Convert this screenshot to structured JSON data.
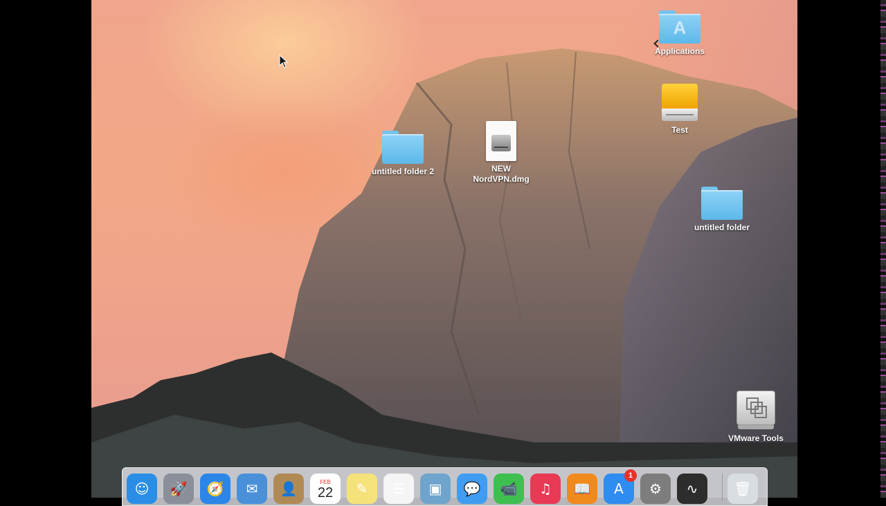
{
  "desktop": {
    "icons": [
      {
        "label": "Applications",
        "kind": "folder-alias"
      },
      {
        "label": "Test",
        "kind": "drive"
      },
      {
        "label": "untitled folder 2",
        "kind": "folder"
      },
      {
        "label": "NEW\nNordVPN.dmg",
        "kind": "dmg"
      },
      {
        "label": "untitled folder",
        "kind": "folder"
      },
      {
        "label": "VMware Tools",
        "kind": "vmware-volume"
      }
    ]
  },
  "dock": {
    "items": [
      {
        "name": "finder-icon",
        "glyph": "☺",
        "color": "#2a8ee6"
      },
      {
        "name": "launchpad-icon",
        "glyph": "🚀",
        "color": "#8a8f9a"
      },
      {
        "name": "safari-icon",
        "glyph": "🧭",
        "color": "#2b86e8"
      },
      {
        "name": "mail-icon",
        "glyph": "✉",
        "color": "#4a90d9"
      },
      {
        "name": "contacts-icon",
        "glyph": "👤",
        "color": "#b08a55"
      },
      {
        "name": "calendar-icon",
        "month": "FEB",
        "day": "22",
        "color": "#ffffff"
      },
      {
        "name": "notes-icon",
        "glyph": "✎",
        "color": "#f6e27a"
      },
      {
        "name": "reminders-icon",
        "glyph": "☰",
        "color": "#f5f5f5"
      },
      {
        "name": "photo-booth-icon",
        "glyph": "▣",
        "color": "#6fa4cc"
      },
      {
        "name": "messages-icon",
        "glyph": "💬",
        "color": "#3f9cf0"
      },
      {
        "name": "facetime-icon",
        "glyph": "📹",
        "color": "#3fbf4f"
      },
      {
        "name": "itunes-icon",
        "glyph": "♫",
        "color": "#e83a55"
      },
      {
        "name": "ibooks-icon",
        "glyph": "📖",
        "color": "#f18a1c"
      },
      {
        "name": "app-store-icon",
        "glyph": "A",
        "color": "#2f8cf0",
        "badge": "1"
      },
      {
        "name": "system-preferences-icon",
        "glyph": "⚙",
        "color": "#7d7d7d"
      },
      {
        "name": "activity-monitor-icon",
        "glyph": "∿",
        "color": "#2d2d2d"
      },
      {
        "name": "trash-icon",
        "glyph": "🗑",
        "color": "#d8dde2"
      }
    ]
  }
}
